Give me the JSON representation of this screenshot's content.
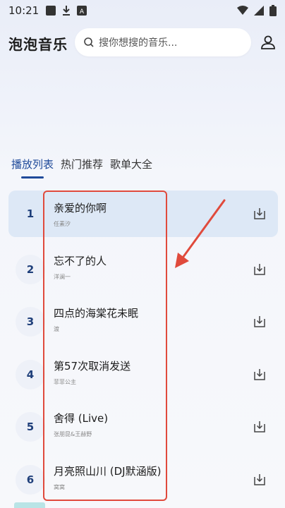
{
  "status_bar": {
    "time": "10:21"
  },
  "header": {
    "app_title": "泡泡音乐",
    "search_placeholder": "搜你想搜的音乐..."
  },
  "tabs": [
    {
      "label": "播放列表",
      "active": true
    },
    {
      "label": "热门推荐",
      "active": false
    },
    {
      "label": "歌单大全",
      "active": false
    }
  ],
  "songs": [
    {
      "num": "1",
      "title": "亲爱的你啊",
      "artist": "任素汐",
      "active": true
    },
    {
      "num": "2",
      "title": "忘不了的人",
      "artist": "洋澜一",
      "active": false
    },
    {
      "num": "3",
      "title": "四点的海棠花未眠",
      "artist": "渡",
      "active": false
    },
    {
      "num": "4",
      "title": "第57次取消发送",
      "artist": "菲菲公主",
      "active": false
    },
    {
      "num": "5",
      "title": "舍得 (Live)",
      "artist": "张朋昆&王赫野",
      "active": false
    },
    {
      "num": "6",
      "title": "月亮照山川 (DJ默涵版)",
      "artist": "窝窝",
      "active": false
    }
  ],
  "colors": {
    "accent": "#1f4a9a",
    "highlight": "#e04a3c",
    "active_row": "#dde8f6"
  },
  "icons": {
    "search": "search-icon",
    "user": "user-icon",
    "download": "download-icon"
  }
}
